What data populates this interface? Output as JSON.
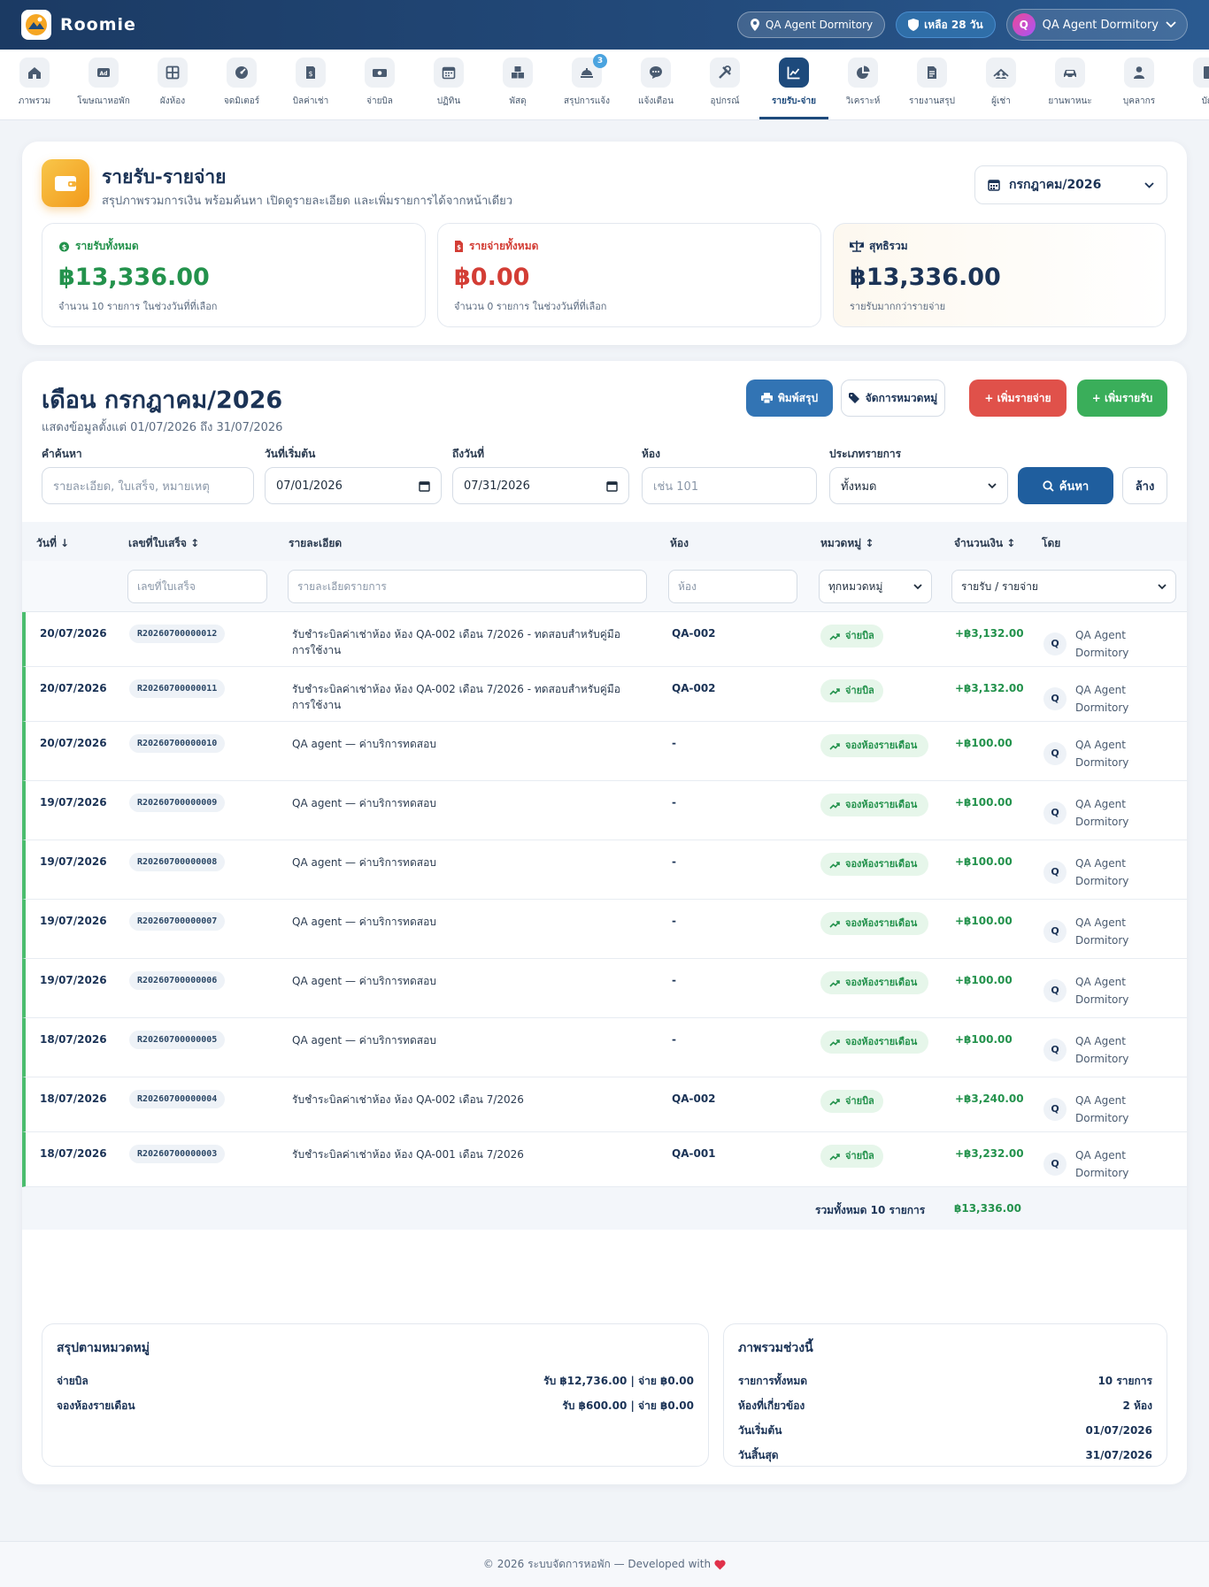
{
  "app": {
    "name": "Roomie",
    "location_label": "QA Agent Dormitory",
    "days_left": "เหลือ 28 วัน",
    "user_initial": "Q",
    "user_name": "QA Agent Dormitory"
  },
  "nav": [
    {
      "label": "ภาพรวม",
      "icon": "home-icon"
    },
    {
      "label": "โฆษณาหอพัก",
      "icon": "ad-icon"
    },
    {
      "label": "ผังห้อง",
      "icon": "grid-icon"
    },
    {
      "label": "จดมิเตอร์",
      "icon": "gauge-icon"
    },
    {
      "label": "บิลค่าเช่า",
      "icon": "bill-icon"
    },
    {
      "label": "จ่ายบิล",
      "icon": "money-icon"
    },
    {
      "label": "ปฏิทิน",
      "icon": "calendar-icon"
    },
    {
      "label": "พัสดุ",
      "icon": "boxes-icon"
    },
    {
      "label": "สรุปการแจ้ง",
      "icon": "bell-service-icon",
      "badge": "3"
    },
    {
      "label": "แจ้งเตือน",
      "icon": "chat-icon"
    },
    {
      "label": "อุปกรณ์",
      "icon": "tools-icon"
    },
    {
      "label": "รายรับ-จ่าย",
      "icon": "chart-line-icon",
      "active": true
    },
    {
      "label": "วิเคราะห์",
      "icon": "pie-chart-icon"
    },
    {
      "label": "รายงานสรุป",
      "icon": "report-icon"
    },
    {
      "label": "ผู้เช่า",
      "icon": "people-icon"
    },
    {
      "label": "ยานพาหนะ",
      "icon": "car-icon"
    },
    {
      "label": "บุคลากร",
      "icon": "person-icon"
    },
    {
      "label": "บัญ",
      "icon": "book-icon"
    }
  ],
  "hero": {
    "title": "รายรับ-รายจ่าย",
    "subtitle": "สรุปภาพรวมการเงิน พร้อมค้นหา เปิดดูรายละเอียด และเพิ่มรายการได้จากหน้าเดียว",
    "month": "กรกฎาคม/2026"
  },
  "stats": {
    "income": {
      "label": "รายรับทั้งหมด",
      "value": "฿13,336.00",
      "note": "จำนวน 10 รายการ ในช่วงวันที่ที่เลือก"
    },
    "expense": {
      "label": "รายจ่ายทั้งหมด",
      "value": "฿0.00",
      "note": "จำนวน 0 รายการ ในช่วงวันที่ที่เลือก"
    },
    "net": {
      "label": "สุทธิรวม",
      "value": "฿13,336.00",
      "note": "รายรับมากกว่ารายจ่าย"
    }
  },
  "section": {
    "title": "เดือน กรกฎาคม/2026",
    "subtitle": "แสดงข้อมูลตั้งแต่ 01/07/2026 ถึง 31/07/2026",
    "print_label": "พิมพ์สรุป",
    "categories_label": "จัดการหมวดหมู่",
    "add_expense_label": "+ เพิ่มรายจ่าย",
    "add_income_label": "+ เพิ่มรายรับ"
  },
  "filters": {
    "search_label": "คำค้นหา",
    "search_placeholder": "รายละเอียด, ใบเสร็จ, หมายเหตุ",
    "start_label": "วันที่เริ่มต้น",
    "start_value": "07/01/2026",
    "end_label": "ถึงวันที่",
    "end_value": "07/31/2026",
    "room_label": "ห้อง",
    "room_placeholder": "เช่น 101",
    "type_label": "ประเภทรายการ",
    "type_value": "ทั้งหมด",
    "search_button": "ค้นหา",
    "clear_button": "ล้าง"
  },
  "table": {
    "headers": {
      "date": "วันที่ ↓",
      "receipt": "เลขที่ใบเสร็จ ↕",
      "detail": "รายละเอียด",
      "room": "ห้อง",
      "category": "หมวดหมู่ ↕",
      "amount": "จำนวนเงิน ↕",
      "by": "โดย"
    },
    "col_filters": {
      "receipt": "เลขที่ใบเสร็จ",
      "detail": "รายละเอียดรายการ",
      "room": "ห้อง",
      "category": "ทุกหมวดหมู่",
      "type": "รายรับ / รายจ่าย"
    },
    "rows": [
      {
        "date": "20/07/2026",
        "receipt": "R20260700000012",
        "detail": "รับชำระบิลค่าเช่าห้อง ห้อง QA-002 เดือน 7/2026 - ทดสอบสำหรับคู่มือการใช้งาน",
        "room": "QA-002",
        "category": "จ่ายบิล",
        "amount": "+฿3,132.00",
        "by_initial": "Q",
        "by": "QA Agent Dormitory"
      },
      {
        "date": "20/07/2026",
        "receipt": "R20260700000011",
        "detail": "รับชำระบิลค่าเช่าห้อง ห้อง QA-002 เดือน 7/2026 - ทดสอบสำหรับคู่มือการใช้งาน",
        "room": "QA-002",
        "category": "จ่ายบิล",
        "amount": "+฿3,132.00",
        "by_initial": "Q",
        "by": "QA Agent Dormitory"
      },
      {
        "date": "20/07/2026",
        "receipt": "R20260700000010",
        "detail": "QA agent — ค่าบริการทดสอบ",
        "room": "-",
        "category": "จองห้องรายเดือน",
        "amount": "+฿100.00",
        "by_initial": "Q",
        "by": "QA Agent Dormitory"
      },
      {
        "date": "19/07/2026",
        "receipt": "R20260700000009",
        "detail": "QA agent — ค่าบริการทดสอบ",
        "room": "-",
        "category": "จองห้องรายเดือน",
        "amount": "+฿100.00",
        "by_initial": "Q",
        "by": "QA Agent Dormitory"
      },
      {
        "date": "19/07/2026",
        "receipt": "R20260700000008",
        "detail": "QA agent — ค่าบริการทดสอบ",
        "room": "-",
        "category": "จองห้องรายเดือน",
        "amount": "+฿100.00",
        "by_initial": "Q",
        "by": "QA Agent Dormitory"
      },
      {
        "date": "19/07/2026",
        "receipt": "R20260700000007",
        "detail": "QA agent — ค่าบริการทดสอบ",
        "room": "-",
        "category": "จองห้องรายเดือน",
        "amount": "+฿100.00",
        "by_initial": "Q",
        "by": "QA Agent Dormitory"
      },
      {
        "date": "19/07/2026",
        "receipt": "R20260700000006",
        "detail": "QA agent — ค่าบริการทดสอบ",
        "room": "-",
        "category": "จองห้องรายเดือน",
        "amount": "+฿100.00",
        "by_initial": "Q",
        "by": "QA Agent Dormitory"
      },
      {
        "date": "18/07/2026",
        "receipt": "R20260700000005",
        "detail": "QA agent — ค่าบริการทดสอบ",
        "room": "-",
        "category": "จองห้องรายเดือน",
        "amount": "+฿100.00",
        "by_initial": "Q",
        "by": "QA Agent Dormitory"
      },
      {
        "date": "18/07/2026",
        "receipt": "R20260700000004",
        "detail": "รับชำระบิลค่าเช่าห้อง ห้อง QA-002 เดือน 7/2026",
        "room": "QA-002",
        "category": "จ่ายบิล",
        "amount": "+฿3,240.00",
        "by_initial": "Q",
        "by": "QA Agent Dormitory"
      },
      {
        "date": "18/07/2026",
        "receipt": "R20260700000003",
        "detail": "รับชำระบิลค่าเช่าห้อง ห้อง QA-001 เดือน 7/2026",
        "room": "QA-001",
        "category": "จ่ายบิล",
        "amount": "+฿3,232.00",
        "by_initial": "Q",
        "by": "QA Agent Dormitory"
      }
    ],
    "total_label": "รวมทั้งหมด 10 รายการ",
    "total_value": "฿13,336.00"
  },
  "summary_by_category": {
    "title": "สรุปตามหมวดหมู่",
    "items": [
      {
        "name": "จ่ายบิล",
        "value": "รับ ฿12,736.00 | จ่าย ฿0.00"
      },
      {
        "name": "จองห้องรายเดือน",
        "value": "รับ ฿600.00 | จ่าย ฿0.00"
      }
    ]
  },
  "overview": {
    "title": "ภาพรวมช่วงนี้",
    "items": [
      {
        "name": "รายการทั้งหมด",
        "value": "10 รายการ"
      },
      {
        "name": "ห้องที่เกี่ยวข้อง",
        "value": "2 ห้อง"
      },
      {
        "name": "วันเริ่มต้น",
        "value": "01/07/2026"
      },
      {
        "name": "วันสิ้นสุด",
        "value": "31/07/2026"
      }
    ]
  },
  "footer": {
    "text": "© 2026 ระบบจัดการหอพัก — Developed with"
  },
  "colors": {
    "brand": "#1d4a7c",
    "income": "#23924c",
    "expense": "#d33d35",
    "accent": "#f29a1b"
  }
}
